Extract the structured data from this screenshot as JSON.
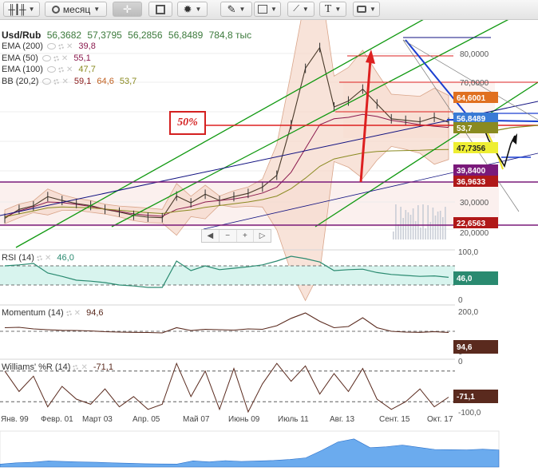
{
  "toolbar": {
    "period_label": "месяц",
    "text_tool_label": "T"
  },
  "legend": {
    "symbol": "Usd/Rub",
    "ohlc": [
      "56,3682",
      "57,3795",
      "56,2856",
      "56,8489"
    ],
    "volume": "784,8 тыс",
    "indicators": [
      {
        "name": "EMA (200)",
        "value": "39,8",
        "color": "#8b1a4e"
      },
      {
        "name": "EMA (50)",
        "value": "55,1",
        "color": "#8b1a4e"
      },
      {
        "name": "EMA (100)",
        "value": "47,7",
        "color": "#8a8a20"
      },
      {
        "name": "BB (20,2)",
        "values": [
          "59,1",
          "64,6",
          "53,7"
        ],
        "colors": [
          "#8b1a1a",
          "#c06020",
          "#8a8a20"
        ]
      }
    ]
  },
  "annotation": {
    "label": "50%"
  },
  "navigator": {
    "buttons": [
      "◀",
      "−",
      "+",
      "▷"
    ]
  },
  "chart_data": [
    {
      "type": "line",
      "title": "Usd/Rub",
      "y_ticks": [
        "80,0000",
        "70,0000",
        "30,0000",
        "20,0000"
      ],
      "ylim": [
        20,
        85
      ],
      "x_ticks": [
        "Янв. 99",
        "Февр. 01",
        "Март 03",
        "Апр. 05",
        "Май 07",
        "Июнь 09",
        "Июль 11",
        "Авг. 13",
        "Сент. 15",
        "Окт. 17"
      ],
      "price_labels": [
        {
          "text": "64,6001",
          "value": 64.6,
          "color": "#e07020"
        },
        {
          "text": "56,8489",
          "value": 56.85,
          "color": "#3a7bd5"
        },
        {
          "text": "53,7",
          "value": 53.7,
          "color": "#8a8a20"
        },
        {
          "text": "47,7356",
          "value": 47.7,
          "color": "#eeee33"
        },
        {
          "text": "39,8400",
          "value": 39.8,
          "color": "#7a1a7a"
        },
        {
          "text": "36,9633",
          "value": 36.96,
          "color": "#b01818"
        },
        {
          "text": "22,6563",
          "value": 22.66,
          "color": "#b01818"
        }
      ],
      "series": [
        {
          "name": "Usd/Rub",
          "values": [
            24.5,
            27.5,
            28.7,
            31.8,
            30.5,
            29.5,
            28.8,
            27.5,
            26.6,
            25.5,
            24.9,
            24.7,
            32.0,
            29.7,
            32.6,
            30.5,
            31.8,
            32.9,
            35.0,
            39.0,
            56.0,
            75.0,
            82.0,
            62.0,
            64.0,
            68.0,
            63.0,
            58.0,
            57.5,
            57.0,
            58.5,
            56.85
          ]
        },
        {
          "name": "EMA (50)",
          "values": [
            25.0,
            27.0,
            28.4,
            30.0,
            29.8,
            29.2,
            28.5,
            27.6,
            26.8,
            26.0,
            25.5,
            25.2,
            27.5,
            28.5,
            30.0,
            30.5,
            31.0,
            31.8,
            33.0,
            35.0,
            40.0,
            48.0,
            56.0,
            58.0,
            58.5,
            59.5,
            58.8,
            57.5,
            56.8,
            56.0,
            55.5,
            55.1
          ]
        },
        {
          "name": "EMA (100)",
          "values": [
            25.0,
            26.0,
            27.0,
            28.0,
            28.3,
            28.2,
            28.0,
            27.6,
            27.2,
            26.8,
            26.4,
            26.1,
            26.8,
            27.3,
            28.2,
            28.8,
            29.4,
            30.0,
            30.8,
            32.0,
            34.5,
            38.0,
            42.0,
            44.5,
            45.5,
            46.5,
            47.0,
            47.2,
            47.3,
            47.4,
            47.6,
            47.7
          ]
        }
      ]
    },
    {
      "type": "line",
      "title": "RSI (14)",
      "value_label": "46,0",
      "y_ticks": [
        "100,0",
        "0"
      ],
      "ylim": [
        0,
        100
      ],
      "series": [
        {
          "name": "RSI (14)",
          "values": [
            70,
            72,
            75,
            55,
            48,
            40,
            38,
            35,
            30,
            28,
            25,
            25,
            80,
            60,
            70,
            62,
            65,
            68,
            72,
            80,
            90,
            85,
            78,
            60,
            62,
            63,
            56,
            52,
            50,
            48,
            49,
            46
          ]
        }
      ]
    },
    {
      "type": "line",
      "title": "Momentum (14)",
      "value_label": "94,6",
      "y_ticks": [
        "200,0",
        "0"
      ],
      "ylim": [
        0,
        200
      ],
      "series": [
        {
          "name": "Momentum (14)",
          "values": [
            118,
            120,
            112,
            108,
            105,
            104,
            102,
            98,
            96,
            95,
            94,
            92,
            118,
            104,
            110,
            108,
            106,
            112,
            110,
            128,
            165,
            192,
            150,
            118,
            124,
            168,
            118,
            100,
            96,
            95,
            98,
            94.6
          ]
        }
      ]
    },
    {
      "type": "line",
      "title": "Williams' %R (14)",
      "value_label": "-71,1",
      "y_ticks": [
        "0",
        "-100,0"
      ],
      "ylim": [
        -100,
        0
      ],
      "series": [
        {
          "name": "Williams' %R (14)",
          "values": [
            -20,
            -60,
            -30,
            -90,
            -50,
            -75,
            -85,
            -55,
            -90,
            -70,
            -95,
            -85,
            -5,
            -70,
            -20,
            -95,
            -15,
            -100,
            -45,
            -5,
            -40,
            -10,
            -65,
            -25,
            -60,
            -15,
            -75,
            -95,
            -80,
            -55,
            -90,
            -71.1
          ]
        }
      ]
    }
  ],
  "colors": {
    "channel_green": "#119911",
    "trend_navy": "#101080",
    "support_purple": "#7a1a7a",
    "resistance_red": "#dd2020",
    "arrow_blue": "#1a3fd0",
    "yellow": "#e8e020",
    "rsi_fill": "#d8f4ee",
    "rsi_line": "#2a8a70",
    "indicator_label_bg": "#5a2a1e",
    "volume_blue": "#3a8fe8"
  }
}
